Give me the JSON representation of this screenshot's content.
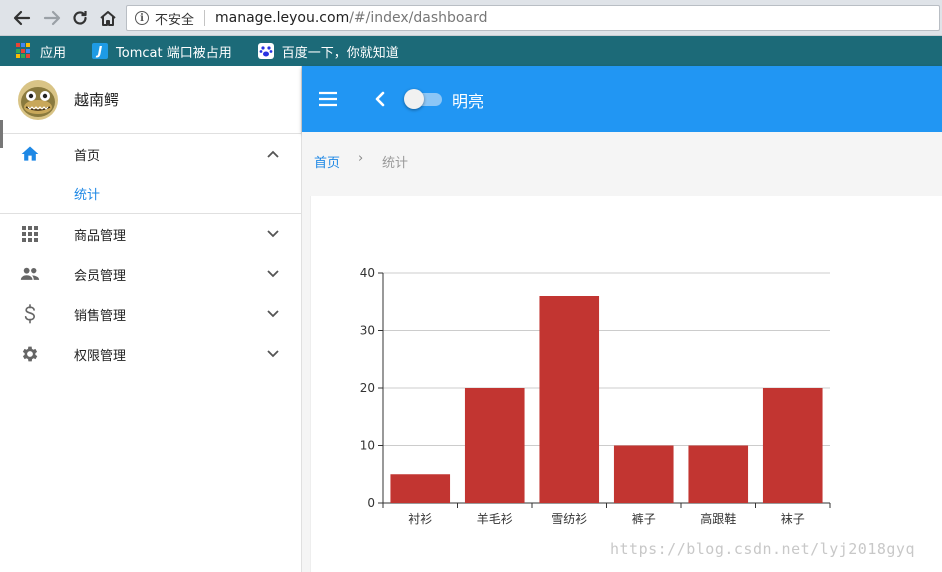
{
  "browser": {
    "security_label": "不安全",
    "url_host": "manage.leyou.com",
    "url_path": "/#/index/dashboard",
    "bookmarks": [
      {
        "label": "应用",
        "icon": "apps-grid-icon"
      },
      {
        "label": "Tomcat 端口被占用",
        "icon": "j-app-icon"
      },
      {
        "label": "百度一下，你就知道",
        "icon": "baidu-paw-icon"
      }
    ]
  },
  "sidebar": {
    "username": "越南鳄",
    "items": [
      {
        "label": "首页",
        "icon": "home-icon",
        "expanded": true,
        "children": [
          {
            "label": "统计"
          }
        ]
      },
      {
        "label": "商品管理",
        "icon": "apps-icon",
        "expanded": false
      },
      {
        "label": "会员管理",
        "icon": "people-icon",
        "expanded": false
      },
      {
        "label": "销售管理",
        "icon": "dollar-icon",
        "expanded": false
      },
      {
        "label": "权限管理",
        "icon": "settings-icon",
        "expanded": false
      }
    ]
  },
  "toolbar": {
    "mode_label": "明亮",
    "toggle_on": false
  },
  "breadcrumb": {
    "home": "首页",
    "separator": "›",
    "current": "统计"
  },
  "chart_data": {
    "type": "bar",
    "categories": [
      "衬衫",
      "羊毛衫",
      "雪纺衫",
      "裤子",
      "高跟鞋",
      "袜子"
    ],
    "values": [
      5,
      20,
      36,
      10,
      10,
      20
    ],
    "ylim": [
      0,
      40
    ],
    "yticks": [
      0,
      10,
      20,
      30,
      40
    ],
    "grid": true,
    "color": "#c23531"
  },
  "watermark": "https://blog.csdn.net/lyj2018gyq",
  "colors": {
    "primary": "#2196f3",
    "link": "#1e88e5",
    "bar": "#c23531",
    "bookmark_bar": "#1c6a78"
  }
}
